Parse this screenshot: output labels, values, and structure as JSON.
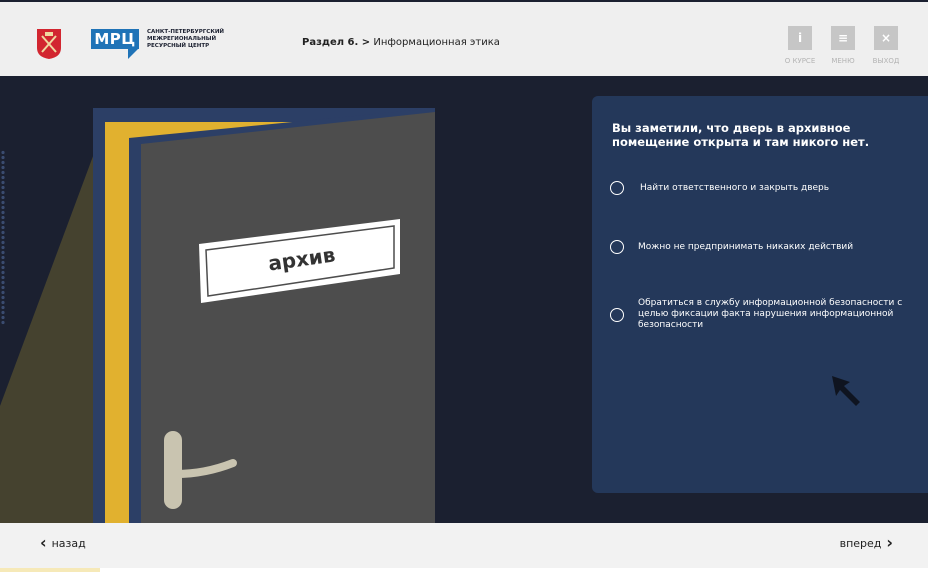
{
  "header": {
    "logo_abbr": "МРЦ",
    "logo_lines": [
      "САНКТ-ПЕТЕРБУРГСКИЙ",
      "МЕЖРЕГИОНАЛЬНЫЙ",
      "РЕСУРСНЫЙ ЦЕНТР"
    ],
    "breadcrumb_section": "Раздел 6. >",
    "breadcrumb_title": "Информационная этика",
    "buttons": [
      {
        "icon": "info-icon",
        "glyph": "i",
        "label": "О КУРСЕ"
      },
      {
        "icon": "menu-icon",
        "glyph": "≡",
        "label": "МЕНЮ"
      },
      {
        "icon": "close-icon",
        "glyph": "×",
        "label": "ВЫХОД"
      }
    ]
  },
  "scene": {
    "door_sign": "архив"
  },
  "question": {
    "text": "Вы заметили, что дверь в архивное помещение открыта и там никого нет.",
    "options": [
      "Найти ответственного и закрыть дверь",
      "Можно не предпринимать никаких действий",
      "Обратиться в службу информационной безопасности с целью фиксации факта нарушения информационной безопасности"
    ]
  },
  "footer": {
    "back_label": "назад",
    "next_label": "вперед"
  },
  "colors": {
    "background": "#1b2030",
    "panel": "#24385a",
    "door": "#4d4d4d",
    "door_frame_blue": "#2c3f66",
    "door_frame_yellow": "#e1b12f",
    "logo_blue": "#1f73b7"
  }
}
